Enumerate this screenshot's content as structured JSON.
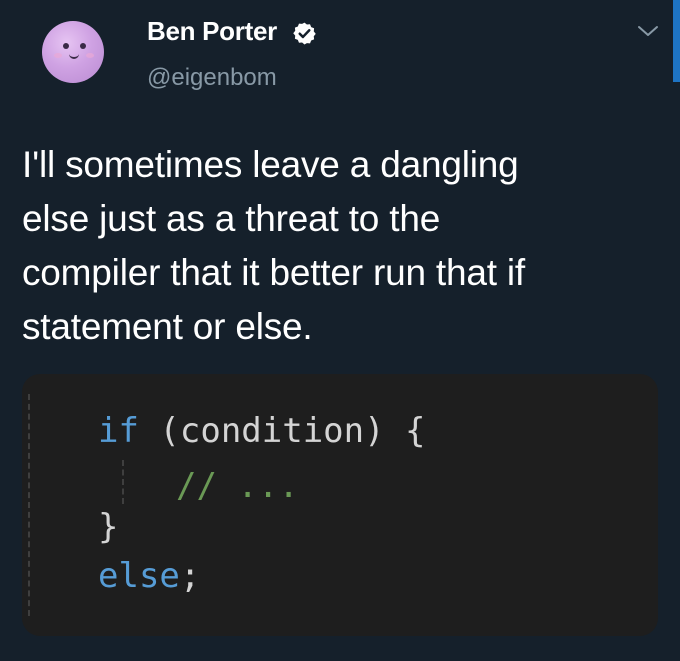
{
  "author": {
    "display_name": "Ben Porter",
    "handle": "@eigenbom",
    "verified": true
  },
  "tweet": {
    "text_lines": [
      "I'll sometimes leave a dangling",
      "else just as a threat to the",
      "compiler that it better run that if",
      "statement or else."
    ]
  },
  "media": {
    "code": {
      "line1_keyword": "if",
      "line1_rest": " (condition) {",
      "line2_comment": "// ...",
      "line3_brace": "}",
      "line4_keyword": "else",
      "line4_rest": ";"
    }
  },
  "icons": {
    "verified": "verified-badge-icon",
    "menu": "chevron-down-icon",
    "avatar": "avatar"
  },
  "colors": {
    "background": "#15202b",
    "handle": "#8899a6",
    "code_background": "#1e1e1e",
    "code_keyword": "#569cd6",
    "code_text": "#d4d4d4",
    "code_comment": "#6a9955",
    "accent": "#1e74c4"
  }
}
